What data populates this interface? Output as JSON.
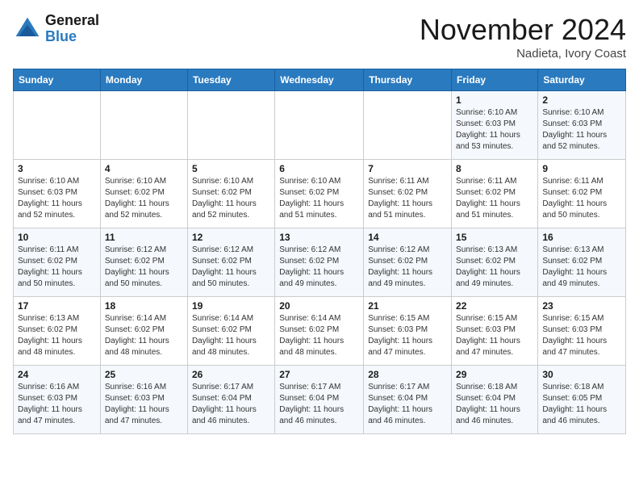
{
  "logo": {
    "line1": "General",
    "line2": "Blue"
  },
  "header": {
    "month": "November 2024",
    "location": "Nadieta, Ivory Coast"
  },
  "weekdays": [
    "Sunday",
    "Monday",
    "Tuesday",
    "Wednesday",
    "Thursday",
    "Friday",
    "Saturday"
  ],
  "weeks": [
    [
      {
        "day": "",
        "info": ""
      },
      {
        "day": "",
        "info": ""
      },
      {
        "day": "",
        "info": ""
      },
      {
        "day": "",
        "info": ""
      },
      {
        "day": "",
        "info": ""
      },
      {
        "day": "1",
        "info": "Sunrise: 6:10 AM\nSunset: 6:03 PM\nDaylight: 11 hours\nand 53 minutes."
      },
      {
        "day": "2",
        "info": "Sunrise: 6:10 AM\nSunset: 6:03 PM\nDaylight: 11 hours\nand 52 minutes."
      }
    ],
    [
      {
        "day": "3",
        "info": "Sunrise: 6:10 AM\nSunset: 6:03 PM\nDaylight: 11 hours\nand 52 minutes."
      },
      {
        "day": "4",
        "info": "Sunrise: 6:10 AM\nSunset: 6:02 PM\nDaylight: 11 hours\nand 52 minutes."
      },
      {
        "day": "5",
        "info": "Sunrise: 6:10 AM\nSunset: 6:02 PM\nDaylight: 11 hours\nand 52 minutes."
      },
      {
        "day": "6",
        "info": "Sunrise: 6:10 AM\nSunset: 6:02 PM\nDaylight: 11 hours\nand 51 minutes."
      },
      {
        "day": "7",
        "info": "Sunrise: 6:11 AM\nSunset: 6:02 PM\nDaylight: 11 hours\nand 51 minutes."
      },
      {
        "day": "8",
        "info": "Sunrise: 6:11 AM\nSunset: 6:02 PM\nDaylight: 11 hours\nand 51 minutes."
      },
      {
        "day": "9",
        "info": "Sunrise: 6:11 AM\nSunset: 6:02 PM\nDaylight: 11 hours\nand 50 minutes."
      }
    ],
    [
      {
        "day": "10",
        "info": "Sunrise: 6:11 AM\nSunset: 6:02 PM\nDaylight: 11 hours\nand 50 minutes."
      },
      {
        "day": "11",
        "info": "Sunrise: 6:12 AM\nSunset: 6:02 PM\nDaylight: 11 hours\nand 50 minutes."
      },
      {
        "day": "12",
        "info": "Sunrise: 6:12 AM\nSunset: 6:02 PM\nDaylight: 11 hours\nand 50 minutes."
      },
      {
        "day": "13",
        "info": "Sunrise: 6:12 AM\nSunset: 6:02 PM\nDaylight: 11 hours\nand 49 minutes."
      },
      {
        "day": "14",
        "info": "Sunrise: 6:12 AM\nSunset: 6:02 PM\nDaylight: 11 hours\nand 49 minutes."
      },
      {
        "day": "15",
        "info": "Sunrise: 6:13 AM\nSunset: 6:02 PM\nDaylight: 11 hours\nand 49 minutes."
      },
      {
        "day": "16",
        "info": "Sunrise: 6:13 AM\nSunset: 6:02 PM\nDaylight: 11 hours\nand 49 minutes."
      }
    ],
    [
      {
        "day": "17",
        "info": "Sunrise: 6:13 AM\nSunset: 6:02 PM\nDaylight: 11 hours\nand 48 minutes."
      },
      {
        "day": "18",
        "info": "Sunrise: 6:14 AM\nSunset: 6:02 PM\nDaylight: 11 hours\nand 48 minutes."
      },
      {
        "day": "19",
        "info": "Sunrise: 6:14 AM\nSunset: 6:02 PM\nDaylight: 11 hours\nand 48 minutes."
      },
      {
        "day": "20",
        "info": "Sunrise: 6:14 AM\nSunset: 6:02 PM\nDaylight: 11 hours\nand 48 minutes."
      },
      {
        "day": "21",
        "info": "Sunrise: 6:15 AM\nSunset: 6:03 PM\nDaylight: 11 hours\nand 47 minutes."
      },
      {
        "day": "22",
        "info": "Sunrise: 6:15 AM\nSunset: 6:03 PM\nDaylight: 11 hours\nand 47 minutes."
      },
      {
        "day": "23",
        "info": "Sunrise: 6:15 AM\nSunset: 6:03 PM\nDaylight: 11 hours\nand 47 minutes."
      }
    ],
    [
      {
        "day": "24",
        "info": "Sunrise: 6:16 AM\nSunset: 6:03 PM\nDaylight: 11 hours\nand 47 minutes."
      },
      {
        "day": "25",
        "info": "Sunrise: 6:16 AM\nSunset: 6:03 PM\nDaylight: 11 hours\nand 47 minutes."
      },
      {
        "day": "26",
        "info": "Sunrise: 6:17 AM\nSunset: 6:04 PM\nDaylight: 11 hours\nand 46 minutes."
      },
      {
        "day": "27",
        "info": "Sunrise: 6:17 AM\nSunset: 6:04 PM\nDaylight: 11 hours\nand 46 minutes."
      },
      {
        "day": "28",
        "info": "Sunrise: 6:17 AM\nSunset: 6:04 PM\nDaylight: 11 hours\nand 46 minutes."
      },
      {
        "day": "29",
        "info": "Sunrise: 6:18 AM\nSunset: 6:04 PM\nDaylight: 11 hours\nand 46 minutes."
      },
      {
        "day": "30",
        "info": "Sunrise: 6:18 AM\nSunset: 6:05 PM\nDaylight: 11 hours\nand 46 minutes."
      }
    ]
  ]
}
